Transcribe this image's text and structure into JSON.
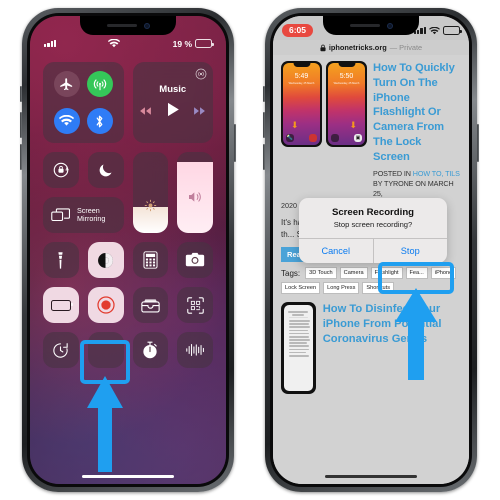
{
  "left_phone": {
    "name": "iphone-control-center",
    "status_bar": {
      "signal_icon": "cellular-bars-icon",
      "wifi_icon": "wifi-icon",
      "battery_percent": "19 %",
      "battery_color": "#f5c518",
      "battery_level": 19
    },
    "connectivity": {
      "airplane_mode": {
        "label": "airplane-mode",
        "state": "off"
      },
      "cellular_data": {
        "label": "cellular-data",
        "state": "on",
        "color": "#35c759"
      },
      "wifi": {
        "label": "wi-fi",
        "state": "on",
        "color": "#2f7cf6"
      },
      "bluetooth": {
        "label": "bluetooth",
        "state": "on",
        "color": "#2f7cf6"
      }
    },
    "music": {
      "title": "Music",
      "airplay_icon": "airplay-audio-icon",
      "rewind_icon": "rewind-icon",
      "play_icon": "play-icon",
      "forward_icon": "fast-forward-icon"
    },
    "tiles": {
      "rotation_lock": "rotation-lock",
      "do_not_disturb": "do-not-disturb",
      "screen_mirroring_line1": "Screen",
      "screen_mirroring_line2": "Mirroring",
      "brightness": {
        "label": "brightness",
        "value": 32
      },
      "volume": {
        "label": "volume",
        "value": 88
      },
      "flashlight": "flashlight",
      "dark_mode": "dark-mode",
      "calculator": "calculator",
      "camera": "camera",
      "low_power_mode": "low-power-mode",
      "screen_recording": "screen-recording",
      "wallet": "wallet",
      "code_scanner": "code-scanner",
      "timer": "timer",
      "alarm": "alarm",
      "stopwatch": "stopwatch",
      "hearing": "hearing"
    },
    "highlight": {
      "target": "screen-recording-button",
      "color": "#1f9ff0",
      "arrow": "blue-up-arrow"
    }
  },
  "right_phone": {
    "name": "safari-private-browsing",
    "status_bar": {
      "recording_time": "6:05",
      "recording_pill_color": "#e8483f",
      "signal_icon": "cellular-bars-icon",
      "wifi_icon": "wifi-icon",
      "battery_icon": "battery-icon"
    },
    "url_bar": {
      "lock_icon": "lock-icon",
      "domain": "iphonetricks.org",
      "private_label": "— Private"
    },
    "article_1": {
      "title": "How To Quickly Turn On The iPhone Flashlight Or Camera From The Lock Screen",
      "posted_in_prefix": "POSTED IN ",
      "categories": "HOW TO, TILS",
      "by_text": " BY TYRONE ON MARCH 25,",
      "year": "2020",
      "body": "It's hard not to notice the two icons available in th... Scr... sho... the... sha... trig...",
      "thumb_1_time": "5:49",
      "thumb_2_time": "5:50",
      "thumb_date": "Wednesday, 25 March",
      "read_more_label": "Read More",
      "read_more_arrow": "→"
    },
    "tags": {
      "label": "Tags:",
      "items": [
        "3D Touch",
        "Camera",
        "Flashlight",
        "Fea...",
        "iPhone",
        "Lock Screen",
        "Long Press",
        "Shortcuts"
      ]
    },
    "article_2": {
      "title": "How To Disinfect Your iPhone From Potential Coronavirus Germs",
      "shot_heading": "Is it OK to use a disinfectant on my Apple product?",
      "shot_body": "Using a 70 percent isopropyl alcohol wipe or Clorox Disinfecting Wipes, you may gently wipe the hard, nonporous surfaces of your Apple product, such as the display, keyboard, or other exterior surfaces. Don't use bleach. Avoid getting moisture in any opening, and don't submerge your Apple product"
    },
    "alert": {
      "title": "Screen Recording",
      "message": "Stop screen recording?",
      "cancel_label": "Cancel",
      "stop_label": "Stop",
      "button_color": "#0a7bf0"
    },
    "highlight": {
      "target": "stop-button",
      "color": "#1f9ff0",
      "arrow": "blue-up-arrow"
    }
  }
}
